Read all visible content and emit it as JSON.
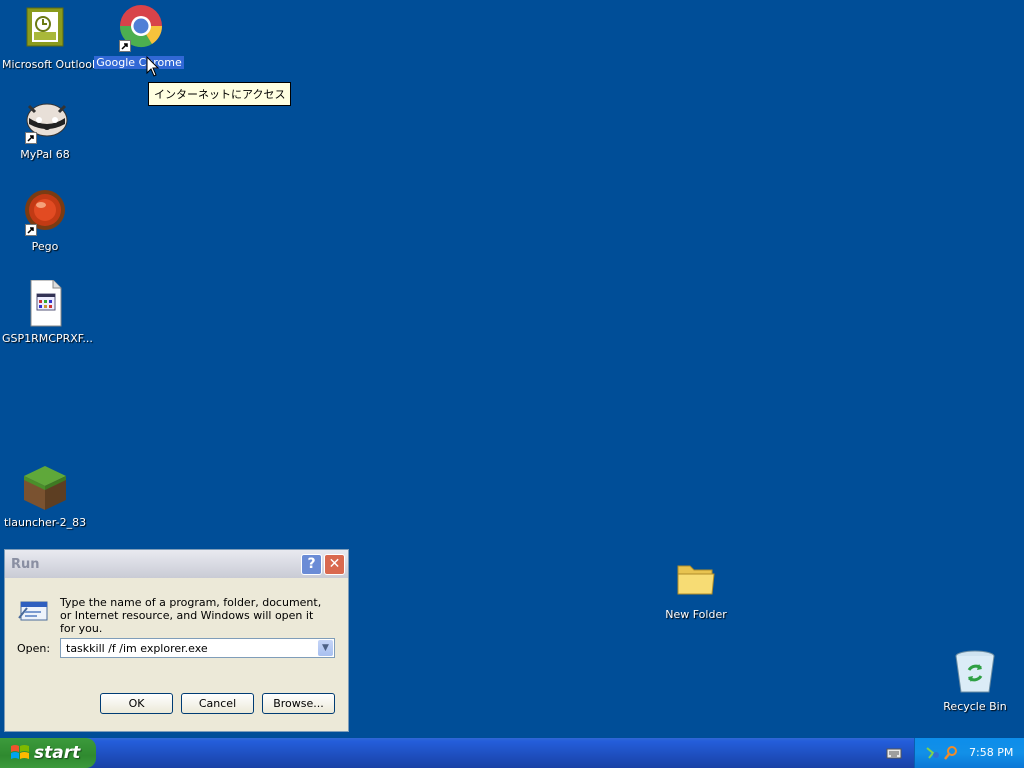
{
  "desktop": {
    "icons": [
      {
        "label": "Microsoft Outlook",
        "icon": "outlook-icon"
      },
      {
        "label": "Google Chrome",
        "icon": "chrome-icon",
        "selected": true
      },
      {
        "label": "MyPal 68",
        "icon": "mypal-icon"
      },
      {
        "label": "Pego",
        "icon": "pego-icon"
      },
      {
        "label": "GSP1RMCPRXF...",
        "icon": "document-icon"
      },
      {
        "label": "tlauncher-2_83",
        "icon": "minecraft-block-icon"
      },
      {
        "label": "New Folder",
        "icon": "folder-icon"
      },
      {
        "label": "Recycle Bin",
        "icon": "recycle-bin-icon"
      }
    ],
    "tooltip": "インターネットにアクセス"
  },
  "run_dialog": {
    "title": "Run",
    "help_label": "?",
    "close_label": "✕",
    "description": "Type the name of a program, folder, document, or Internet resource, and Windows will open it for you.",
    "open_label": "Open:",
    "open_value": "taskkill /f /im explorer.exe",
    "dropdown_glyph": "▼",
    "ok_label": "OK",
    "cancel_label": "Cancel",
    "browse_label": "Browse..."
  },
  "taskbar": {
    "start_label": "start",
    "clock": "7:58 PM"
  },
  "colors": {
    "desktop_bg": "#004e98",
    "taskbar": "#245edb",
    "start_button": "#3c9a3c",
    "tray": "#0d8dea",
    "dialog_bg": "#ece9d8"
  }
}
